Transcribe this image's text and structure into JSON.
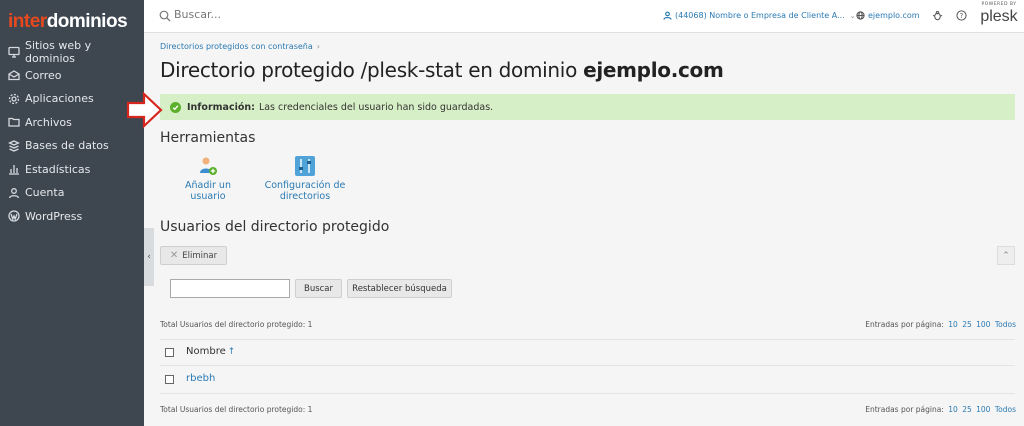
{
  "brand": {
    "logo_inter": "inter",
    "logo_dom": "dominios",
    "accent": "#e8481d"
  },
  "sidebar": {
    "items": [
      {
        "label": "Sitios web y dominios",
        "icon": "monitor-icon"
      },
      {
        "label": "Correo",
        "icon": "mail-icon"
      },
      {
        "label": "Aplicaciones",
        "icon": "gear-icon"
      },
      {
        "label": "Archivos",
        "icon": "folder-icon"
      },
      {
        "label": "Bases de datos",
        "icon": "database-icon"
      },
      {
        "label": "Estadísticas",
        "icon": "bar-chart-icon"
      },
      {
        "label": "Cuenta",
        "icon": "user-icon"
      },
      {
        "label": "WordPress",
        "icon": "wordpress-icon"
      }
    ]
  },
  "topbar": {
    "search_placeholder": "Buscar...",
    "account": "(44068) Nombre o Empresa de Cliente A...",
    "domain": "ejemplo.com",
    "plesk_powered": "POWERED BY",
    "plesk_word": "plesk"
  },
  "breadcrumb": {
    "item": "Directorios protegidos con contraseña",
    "sep": "›"
  },
  "page": {
    "title_prefix": "Directorio protegido /plesk-stat en dominio ",
    "title_domain": "ejemplo.com"
  },
  "info": {
    "label": "Información:",
    "message": "Las credenciales del usuario han sido guardadas.",
    "color": "#d7efc6"
  },
  "tools": {
    "heading": "Herramientas",
    "add_user": "Añadir un usuario",
    "config_line1": "Configuración de",
    "config_line2": "directorios"
  },
  "users": {
    "heading": "Usuarios del directorio protegido",
    "delete_label": "Eliminar",
    "search_label": "Buscar",
    "reset_label": "Restablecer búsqueda",
    "filter_value": "",
    "total_text": "Total Usuarios del directorio protegido: 1",
    "perpage_label": "Entradas por página:",
    "perpage_options": [
      "10",
      "25",
      "100",
      "Todos"
    ],
    "column_name": "Nombre",
    "sort_arrow": "↑",
    "rows": [
      {
        "name": "rbebh"
      }
    ]
  }
}
